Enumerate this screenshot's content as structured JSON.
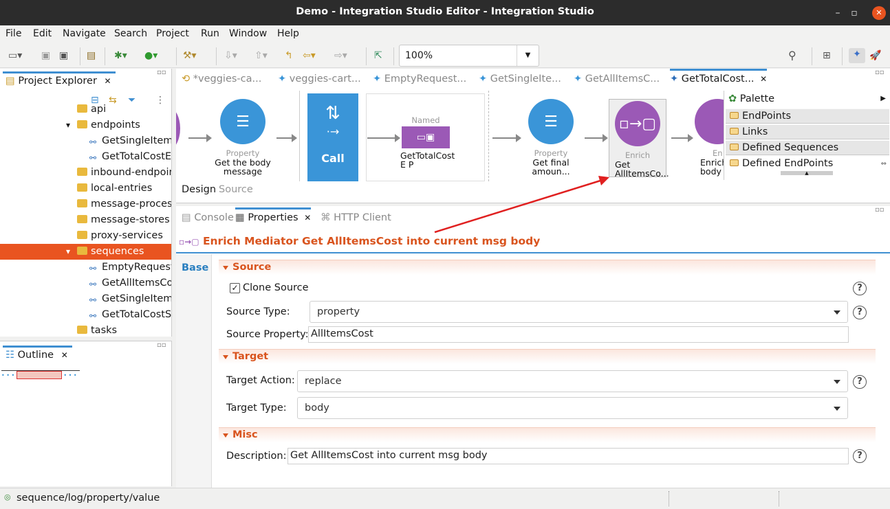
{
  "window": {
    "title": "Demo - Integration Studio Editor - Integration Studio"
  },
  "menu": [
    "File",
    "Edit",
    "Navigate",
    "Search",
    "Project",
    "Run",
    "Window",
    "Help"
  ],
  "toolbar": {
    "zoom": "100%"
  },
  "project_explorer": {
    "title": "Project Explorer",
    "items": [
      {
        "label": "api",
        "type": "folder",
        "level": 1
      },
      {
        "label": "endpoints",
        "type": "folder",
        "level": 1,
        "expanded": true
      },
      {
        "label": "GetSingleItemE",
        "type": "seq",
        "level": 2
      },
      {
        "label": "GetTotalCostEP",
        "type": "seq",
        "level": 2
      },
      {
        "label": "inbound-endpoint",
        "type": "folder",
        "level": 1
      },
      {
        "label": "local-entries",
        "type": "folder",
        "level": 1
      },
      {
        "label": "message-processo",
        "type": "folder",
        "level": 1
      },
      {
        "label": "message-stores",
        "type": "folder",
        "level": 1
      },
      {
        "label": "proxy-services",
        "type": "folder",
        "level": 1
      },
      {
        "label": "sequences",
        "type": "folder",
        "level": 1,
        "expanded": true,
        "selected": true
      },
      {
        "label": "EmptyRequestS",
        "type": "seq",
        "level": 2
      },
      {
        "label": "GetAllItemsCos",
        "type": "seq",
        "level": 2
      },
      {
        "label": "GetSingleItemC",
        "type": "seq",
        "level": 2
      },
      {
        "label": "GetTotalCostSe",
        "type": "seq",
        "level": 2
      },
      {
        "label": "tasks",
        "type": "folder",
        "level": 1
      }
    ]
  },
  "outline": {
    "title": "Outline"
  },
  "editor": {
    "tabs": [
      "*veggies-ca...",
      "veggies-cart...",
      "EmptyRequest...",
      "GetSingleIte...",
      "GetAllItemsC...",
      "GetTotalCost..."
    ],
    "active_tab": "GetTotalCost...",
    "mediators": [
      {
        "type": "Property",
        "label": "Get the body message"
      },
      {
        "type": "Call",
        "label": "Call"
      },
      {
        "type": "Named",
        "label": "GetTotalCostE P"
      },
      {
        "type": "Property",
        "label": "Get final amoun..."
      },
      {
        "type": "Enrich",
        "label": "Get AllItemsCo..."
      },
      {
        "type": "En",
        "label": "Enrich body"
      }
    ],
    "bottom_tabs": {
      "design": "Design",
      "source": "Source"
    },
    "palette": {
      "title": "Palette",
      "items": [
        "EndPoints",
        "Links",
        "Defined Sequences",
        "Defined EndPoints"
      ]
    }
  },
  "views": {
    "tabs": [
      "Console",
      "Properties",
      "HTTP Client"
    ],
    "active": "Properties"
  },
  "properties": {
    "title": "Enrich Mediator Get AllItemsCost into current msg body",
    "base_tab": "Base",
    "source": {
      "header": "Source",
      "clone_label": "Clone Source",
      "clone_checked": true,
      "type_label": "Source Type:",
      "type_value": "property",
      "property_label": "Source Property:",
      "property_value": "AllItemsCost"
    },
    "target": {
      "header": "Target",
      "action_label": "Target Action:",
      "action_value": "replace",
      "type_label": "Target Type:",
      "type_value": "body"
    },
    "misc": {
      "header": "Misc",
      "desc_label": "Description:",
      "desc_value": "Get AllItemsCost into current msg body"
    }
  },
  "status": {
    "text": "sequence/log/property/value"
  },
  "colors": {
    "accent": "#3f8fd1",
    "selection": "#e95420",
    "mediator_blue": "#3a95d8",
    "mediator_purple": "#9b59b6",
    "section_text": "#d9541e"
  }
}
